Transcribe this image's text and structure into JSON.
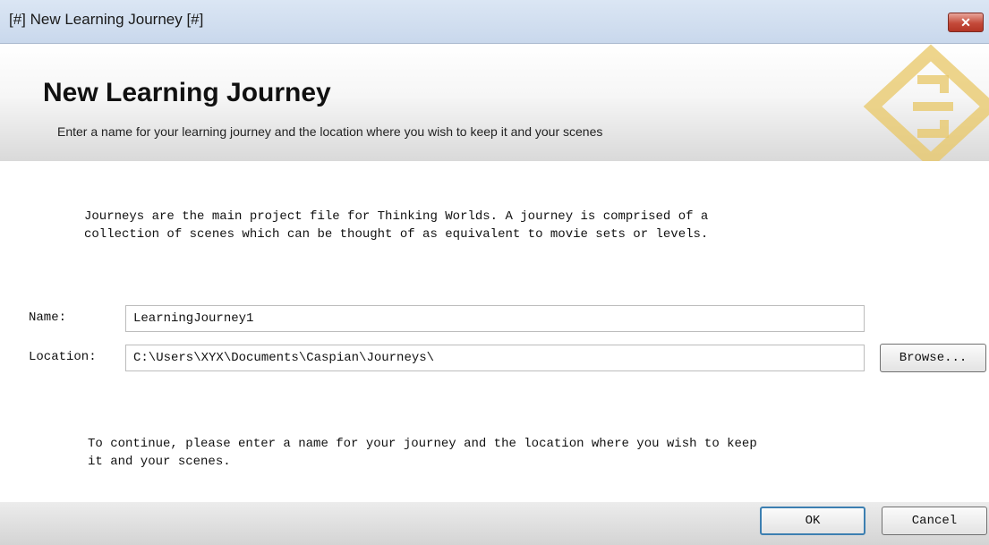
{
  "window": {
    "title": "[#] New Learning Journey [#]",
    "close_glyph": "✕"
  },
  "banner": {
    "heading": "New Learning Journey",
    "subheading": "Enter a name for your learning journey and the location where you wish to keep it and your scenes"
  },
  "intro": {
    "line1": "Journeys are the main project file for Thinking Worlds. A journey is comprised of a",
    "line2": "collection of scenes which can be thought of as equivalent to movie sets or levels."
  },
  "form": {
    "name_label": "Name:",
    "name_value": "LearningJourney1",
    "location_label": "Location:",
    "location_value": "C:\\Users\\XYX\\Documents\\Caspian\\Journeys\\",
    "browse_label": "Browse..."
  },
  "hint": {
    "line1": "To continue, please enter a name for your journey and the location where you wish to keep",
    "line2": "it and your scenes."
  },
  "footer": {
    "ok_label": "OK",
    "cancel_label": "Cancel"
  },
  "colors": {
    "titlebar": "#c9d8ec",
    "close_button": "#c44a3a",
    "logo_gold": "#e8c766",
    "default_button_border": "#3c7fb1"
  }
}
